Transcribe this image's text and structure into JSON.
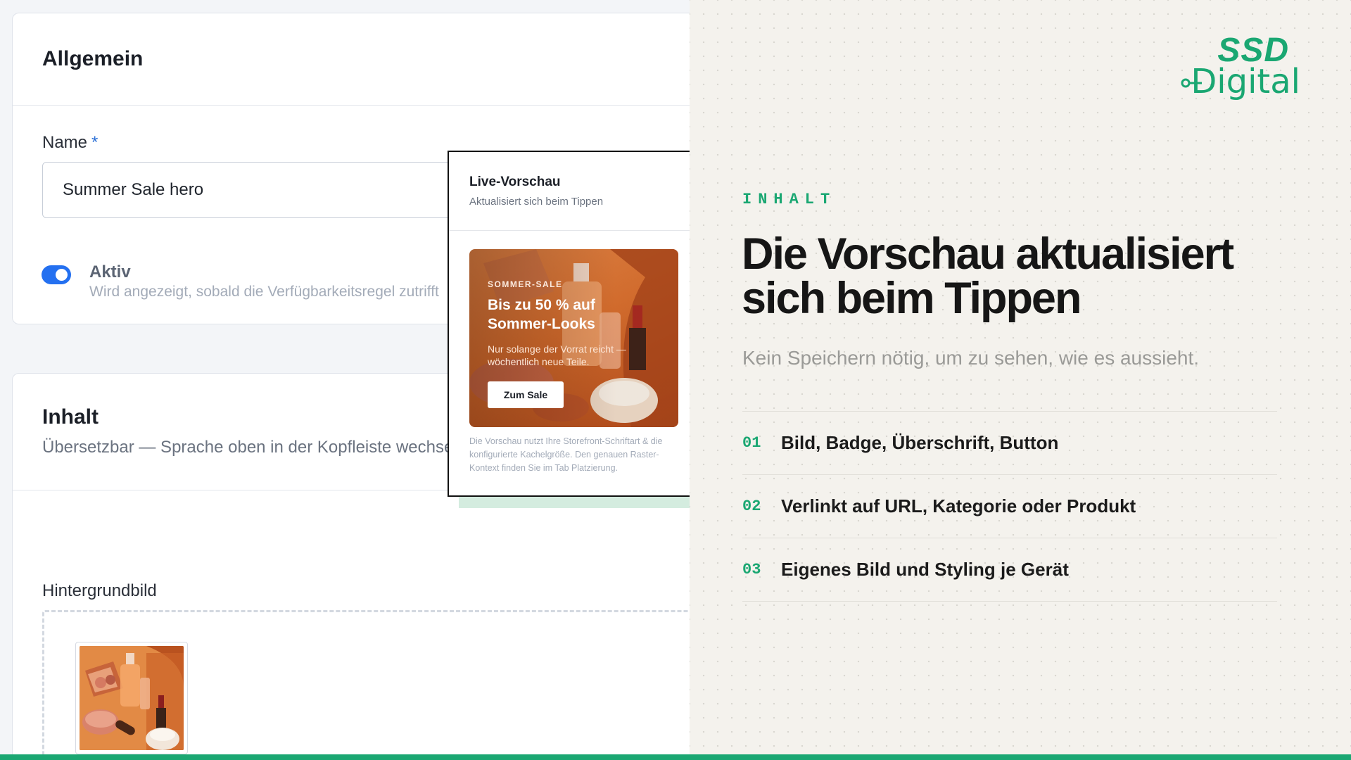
{
  "general": {
    "title": "Allgemein",
    "name_label": "Name",
    "required_mark": "*",
    "name_value": "Summer Sale hero",
    "active_label": "Aktiv",
    "active_hint": "Wird angezeigt, sobald die Verfügbarkeitsregel zutrifft",
    "active_on": true
  },
  "content": {
    "title": "Inhalt",
    "subtitle": "Übersetzbar — Sprache oben in der Kopfleiste wechseln",
    "background_label": "Hintergrundbild"
  },
  "preview": {
    "title": "Live-Vorschau",
    "subtitle": "Aktualisiert sich beim Tippen",
    "banner_badge": "SOMMER-SALE",
    "banner_heading": "Bis zu 50 % auf Sommer-Looks",
    "banner_text": "Nur solange der Vorrat reicht — wöchentlich neue Teile.",
    "banner_button": "Zum Sale",
    "note": "Die Vorschau nutzt Ihre Storefront-Schriftart & die konfigurierte Kachelgröße. Den genauen Raster-Kontext finden Sie im Tab Platzierung."
  },
  "info": {
    "logo_top": "SSD",
    "logo_bottom": "Digital",
    "eyebrow": "INHALT",
    "headline": "Die Vorschau aktualisiert sich beim Tippen",
    "subline": "Kein Speichern nötig, um zu sehen, wie es aussieht.",
    "features": [
      {
        "num": "01",
        "text": "Bild, Badge, Überschrift, Button"
      },
      {
        "num": "02",
        "text": "Verlinkt auf URL, Kategorie oder Produkt"
      },
      {
        "num": "03",
        "text": "Eigenes Bild und Styling je Gerät"
      }
    ]
  },
  "colors": {
    "accent": "#1aa772",
    "toggle_on": "#2470f0",
    "required": "#2a6fd6"
  }
}
